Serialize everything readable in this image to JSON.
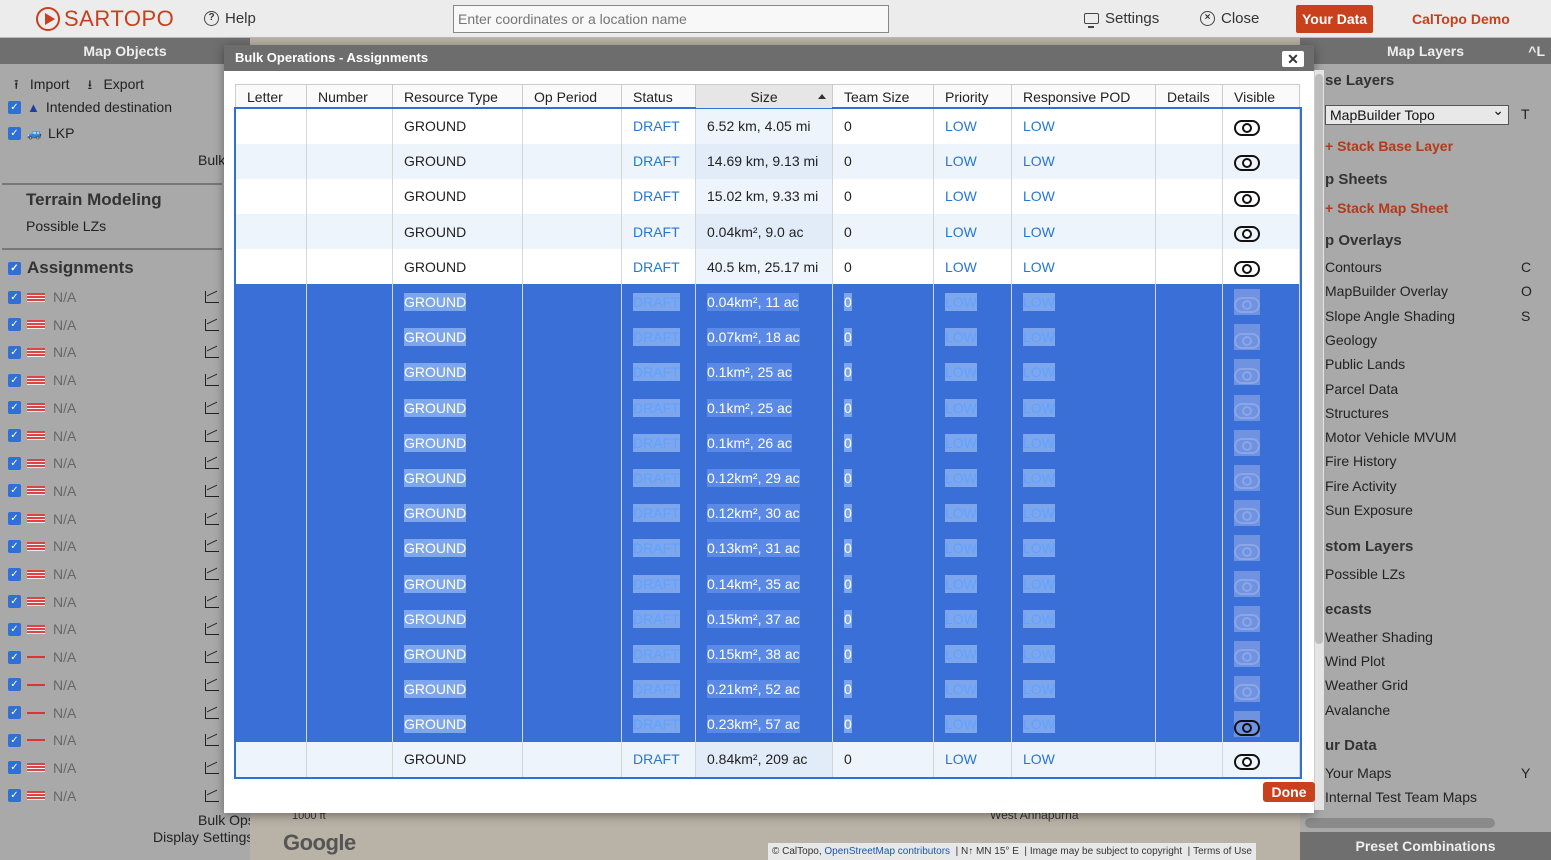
{
  "topbar": {
    "logo_text": "SARTOPO",
    "help_label": "Help",
    "search_placeholder": "Enter coordinates or a location name",
    "settings_label": "Settings",
    "close_label": "Close",
    "your_data_label": "Your Data",
    "account_label": "CalTopo Demo"
  },
  "left_panel": {
    "header": "Map Objects",
    "import_label": "Import",
    "export_label": "Export",
    "intended_destination": "Intended destination",
    "lkp": "LKP",
    "bulk_label": "Bulk",
    "terrain_title": "Terrain Modeling",
    "possible_lzs": "Possible LZs",
    "assignments_title": "Assignments",
    "assignment_rows": [
      "N/A",
      "N/A",
      "N/A",
      "N/A",
      "N/A",
      "N/A",
      "N/A",
      "N/A",
      "N/A",
      "N/A",
      "N/A",
      "N/A",
      "N/A",
      "N/A",
      "N/A",
      "N/A",
      "N/A",
      "N/A",
      "N/A"
    ],
    "bulk_ops": "Bulk Ops",
    "display_settings": "Display Settings"
  },
  "map": {
    "scale": "1000 ft",
    "google": "Google",
    "place": "West Annapurna",
    "attribution_caltopo": "© CalTopo,",
    "attribution_osm": "OpenStreetMap contributors",
    "attribution_mn": "N↑ MN 15° E",
    "attribution_copyright": "Image may be subject to copyright",
    "attribution_terms": "Terms of Use"
  },
  "right_panel": {
    "header": "Map Layers",
    "header_key": "^L",
    "base_layers": "se Layers",
    "base_select": "MapBuilder Topo",
    "base_key": "T",
    "stack_base": "+ Stack Base Layer",
    "map_sheets": "p Sheets",
    "stack_sheet": "+ Stack Map Sheet",
    "overlays_title": "p Overlays",
    "overlays": [
      {
        "label": "Contours",
        "key": "C"
      },
      {
        "label": "MapBuilder Overlay",
        "key": "O"
      },
      {
        "label": "Slope Angle Shading",
        "key": "S"
      },
      {
        "label": "Geology",
        "key": ""
      },
      {
        "label": "Public Lands",
        "key": ""
      },
      {
        "label": "Parcel Data",
        "key": ""
      },
      {
        "label": "Structures",
        "key": ""
      },
      {
        "label": "Motor Vehicle MVUM",
        "key": ""
      },
      {
        "label": "Fire History",
        "key": ""
      },
      {
        "label": "Fire Activity",
        "key": ""
      },
      {
        "label": "Sun Exposure",
        "key": ""
      }
    ],
    "custom_title": "stom Layers",
    "custom_items": [
      "Possible LZs"
    ],
    "forecasts_title": "ecasts",
    "forecast_items": [
      "Weather Shading",
      "Wind Plot",
      "Weather Grid",
      "Avalanche"
    ],
    "your_data_title": "ur Data",
    "your_data_items": [
      {
        "label": "Your Maps",
        "key": "Y"
      },
      {
        "label": "Internal Test Team Maps",
        "key": ""
      }
    ],
    "preset": "Preset Combinations"
  },
  "modal": {
    "title": "Bulk Operations - Assignments",
    "close_symbol": "✕",
    "done_label": "Done",
    "columns": [
      "Letter",
      "Number",
      "Resource Type",
      "Op Period",
      "Status",
      "Size",
      "Team Size",
      "Priority",
      "Responsive POD",
      "Details",
      "Visible"
    ],
    "rows": [
      {
        "letter": "",
        "number": "",
        "type": "GROUND",
        "op": "",
        "status": "DRAFT",
        "size": "6.52 km, 4.05 mi",
        "team": "0",
        "priority": "LOW",
        "pod": "LOW",
        "details": "",
        "selected": false
      },
      {
        "letter": "",
        "number": "",
        "type": "GROUND",
        "op": "",
        "status": "DRAFT",
        "size": "14.69 km, 9.13 mi",
        "team": "0",
        "priority": "LOW",
        "pod": "LOW",
        "details": "",
        "selected": false
      },
      {
        "letter": "",
        "number": "",
        "type": "GROUND",
        "op": "",
        "status": "DRAFT",
        "size": "15.02 km, 9.33 mi",
        "team": "0",
        "priority": "LOW",
        "pod": "LOW",
        "details": "",
        "selected": false
      },
      {
        "letter": "",
        "number": "",
        "type": "GROUND",
        "op": "",
        "status": "DRAFT",
        "size": "0.04km², 9.0 ac",
        "team": "0",
        "priority": "LOW",
        "pod": "LOW",
        "details": "",
        "selected": false
      },
      {
        "letter": "",
        "number": "",
        "type": "GROUND",
        "op": "",
        "status": "DRAFT",
        "size": "40.5 km, 25.17 mi",
        "team": "0",
        "priority": "LOW",
        "pod": "LOW",
        "details": "",
        "selected": false
      },
      {
        "letter": "",
        "number": "",
        "type": "GROUND",
        "op": "",
        "status": "DRAFT",
        "size": "0.04km², 11 ac",
        "team": "0",
        "priority": "LOW",
        "pod": "LOW",
        "details": "",
        "selected": true
      },
      {
        "letter": "",
        "number": "",
        "type": "GROUND",
        "op": "",
        "status": "DRAFT",
        "size": "0.07km², 18 ac",
        "team": "0",
        "priority": "LOW",
        "pod": "LOW",
        "details": "",
        "selected": true
      },
      {
        "letter": "",
        "number": "",
        "type": "GROUND",
        "op": "",
        "status": "DRAFT",
        "size": "0.1km², 25 ac",
        "team": "0",
        "priority": "LOW",
        "pod": "LOW",
        "details": "",
        "selected": true
      },
      {
        "letter": "",
        "number": "",
        "type": "GROUND",
        "op": "",
        "status": "DRAFT",
        "size": "0.1km², 25 ac",
        "team": "0",
        "priority": "LOW",
        "pod": "LOW",
        "details": "",
        "selected": true
      },
      {
        "letter": "",
        "number": "",
        "type": "GROUND",
        "op": "",
        "status": "DRAFT",
        "size": "0.1km², 26 ac",
        "team": "0",
        "priority": "LOW",
        "pod": "LOW",
        "details": "",
        "selected": true
      },
      {
        "letter": "",
        "number": "",
        "type": "GROUND",
        "op": "",
        "status": "DRAFT",
        "size": "0.12km², 29 ac",
        "team": "0",
        "priority": "LOW",
        "pod": "LOW",
        "details": "",
        "selected": true
      },
      {
        "letter": "",
        "number": "",
        "type": "GROUND",
        "op": "",
        "status": "DRAFT",
        "size": "0.12km², 30 ac",
        "team": "0",
        "priority": "LOW",
        "pod": "LOW",
        "details": "",
        "selected": true
      },
      {
        "letter": "",
        "number": "",
        "type": "GROUND",
        "op": "",
        "status": "DRAFT",
        "size": "0.13km², 31 ac",
        "team": "0",
        "priority": "LOW",
        "pod": "LOW",
        "details": "",
        "selected": true
      },
      {
        "letter": "",
        "number": "",
        "type": "GROUND",
        "op": "",
        "status": "DRAFT",
        "size": "0.14km², 35 ac",
        "team": "0",
        "priority": "LOW",
        "pod": "LOW",
        "details": "",
        "selected": true
      },
      {
        "letter": "",
        "number": "",
        "type": "GROUND",
        "op": "",
        "status": "DRAFT",
        "size": "0.15km², 37 ac",
        "team": "0",
        "priority": "LOW",
        "pod": "LOW",
        "details": "",
        "selected": true
      },
      {
        "letter": "",
        "number": "",
        "type": "GROUND",
        "op": "",
        "status": "DRAFT",
        "size": "0.15km², 38 ac",
        "team": "0",
        "priority": "LOW",
        "pod": "LOW",
        "details": "",
        "selected": true
      },
      {
        "letter": "",
        "number": "",
        "type": "GROUND",
        "op": "",
        "status": "DRAFT",
        "size": "0.21km², 52 ac",
        "team": "0",
        "priority": "LOW",
        "pod": "LOW",
        "details": "",
        "selected": true
      },
      {
        "letter": "",
        "number": "",
        "type": "GROUND",
        "op": "",
        "status": "DRAFT",
        "size": "0.23km², 57 ac",
        "team": "0",
        "priority": "LOW",
        "pod": "LOW",
        "details": "",
        "selected": true
      },
      {
        "letter": "",
        "number": "",
        "type": "GROUND",
        "op": "",
        "status": "DRAFT",
        "size": "0.84km², 209 ac",
        "team": "0",
        "priority": "LOW",
        "pod": "LOW",
        "details": "",
        "selected": false
      }
    ]
  }
}
